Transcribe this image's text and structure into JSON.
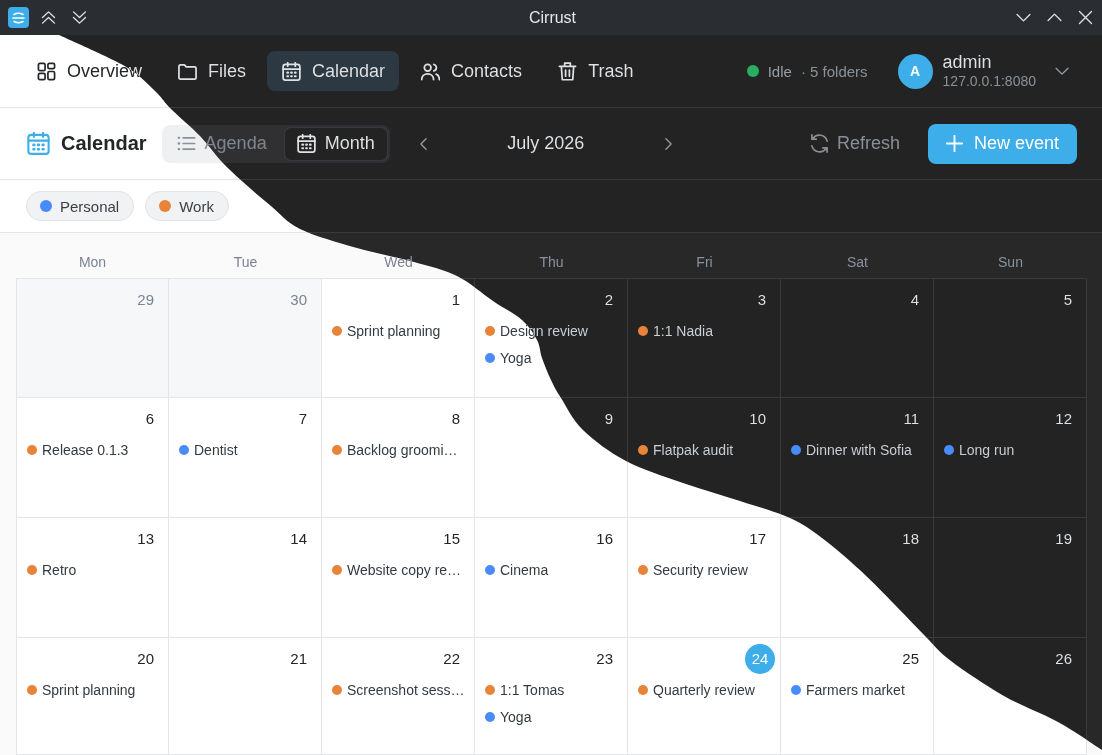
{
  "window": {
    "title": "Cirrust"
  },
  "nav": {
    "tabs": [
      {
        "label": "Overview",
        "selected": false
      },
      {
        "label": "Files",
        "selected": false
      },
      {
        "label": "Calendar",
        "selected": true
      },
      {
        "label": "Contacts",
        "selected": false
      },
      {
        "label": "Trash",
        "selected": false
      }
    ]
  },
  "status": {
    "state": "Idle",
    "folders": "· 5 folders"
  },
  "account": {
    "initial": "A",
    "name": "admin",
    "server": "127.0.0.1:8080"
  },
  "toolbar": {
    "title": "Calendar",
    "views": [
      {
        "label": "Agenda",
        "selected": false
      },
      {
        "label": "Month",
        "selected": true
      }
    ],
    "period": "July 2026",
    "refresh": "Refresh",
    "new_event": "New event"
  },
  "calendars": [
    {
      "label": "Personal",
      "color": "#4a8cf7"
    },
    {
      "label": "Work",
      "color": "#e8833a"
    }
  ],
  "month": {
    "weekdays": [
      "Mon",
      "Tue",
      "Wed",
      "Thu",
      "Fri",
      "Sat",
      "Sun"
    ],
    "weeks": [
      [
        {
          "day": "29",
          "outside": true,
          "today": false
        },
        {
          "day": "30",
          "outside": true,
          "today": false
        },
        {
          "day": "1",
          "outside": false,
          "today": false,
          "events": [
            {
              "title": "Sprint planning",
              "color": "#e8833a"
            }
          ]
        },
        {
          "day": "2",
          "outside": false,
          "today": false,
          "events": [
            {
              "title": "Design review",
              "color": "#e8833a"
            },
            {
              "title": "Yoga",
              "color": "#4a8cf7"
            }
          ]
        },
        {
          "day": "3",
          "outside": false,
          "today": false,
          "events": [
            {
              "title": "1:1 Nadia",
              "color": "#e8833a"
            }
          ]
        },
        {
          "day": "4",
          "outside": false,
          "today": false
        },
        {
          "day": "5",
          "outside": false,
          "today": false
        }
      ],
      [
        {
          "day": "6",
          "outside": false,
          "today": false,
          "events": [
            {
              "title": "Release 0.1.3",
              "color": "#e8833a"
            }
          ]
        },
        {
          "day": "7",
          "outside": false,
          "today": false,
          "events": [
            {
              "title": "Dentist",
              "color": "#4a8cf7"
            }
          ]
        },
        {
          "day": "8",
          "outside": false,
          "today": false,
          "events": [
            {
              "title": "Backlog groomi…",
              "color": "#e8833a"
            }
          ]
        },
        {
          "day": "9",
          "outside": false,
          "today": false
        },
        {
          "day": "10",
          "outside": false,
          "today": false,
          "events": [
            {
              "title": "Flatpak audit",
              "color": "#e8833a"
            }
          ]
        },
        {
          "day": "11",
          "outside": false,
          "today": false,
          "events": [
            {
              "title": "Dinner with Sofia",
              "color": "#4a8cf7"
            }
          ]
        },
        {
          "day": "12",
          "outside": false,
          "today": false,
          "events": [
            {
              "title": "Long run",
              "color": "#4a8cf7"
            }
          ]
        }
      ],
      [
        {
          "day": "13",
          "outside": false,
          "today": false,
          "events": [
            {
              "title": "Retro",
              "color": "#e8833a"
            }
          ]
        },
        {
          "day": "14",
          "outside": false,
          "today": false
        },
        {
          "day": "15",
          "outside": false,
          "today": false,
          "events": [
            {
              "title": "Website copy re…",
              "color": "#e8833a"
            }
          ]
        },
        {
          "day": "16",
          "outside": false,
          "today": false,
          "events": [
            {
              "title": "Cinema",
              "color": "#4a8cf7"
            }
          ]
        },
        {
          "day": "17",
          "outside": false,
          "today": false,
          "events": [
            {
              "title": "Security review",
              "color": "#e8833a"
            }
          ]
        },
        {
          "day": "18",
          "outside": false,
          "today": false
        },
        {
          "day": "19",
          "outside": false,
          "today": false
        }
      ],
      [
        {
          "day": "20",
          "outside": false,
          "today": false,
          "events": [
            {
              "title": "Sprint planning",
              "color": "#e8833a"
            }
          ]
        },
        {
          "day": "21",
          "outside": false,
          "today": false
        },
        {
          "day": "22",
          "outside": false,
          "today": false,
          "events": [
            {
              "title": "Screenshot sess…",
              "color": "#e8833a"
            }
          ]
        },
        {
          "day": "23",
          "outside": false,
          "today": false,
          "events": [
            {
              "title": "1:1 Tomas",
              "color": "#e8833a"
            },
            {
              "title": "Yoga",
              "color": "#4a8cf7"
            }
          ]
        },
        {
          "day": "24",
          "outside": false,
          "today": true,
          "events": [
            {
              "title": "Quarterly review",
              "color": "#e8833a"
            }
          ]
        },
        {
          "day": "25",
          "outside": false,
          "today": false,
          "events": [
            {
              "title": "Farmers market",
              "color": "#4a8cf7"
            }
          ]
        },
        {
          "day": "26",
          "outside": false,
          "today": false
        }
      ]
    ]
  }
}
